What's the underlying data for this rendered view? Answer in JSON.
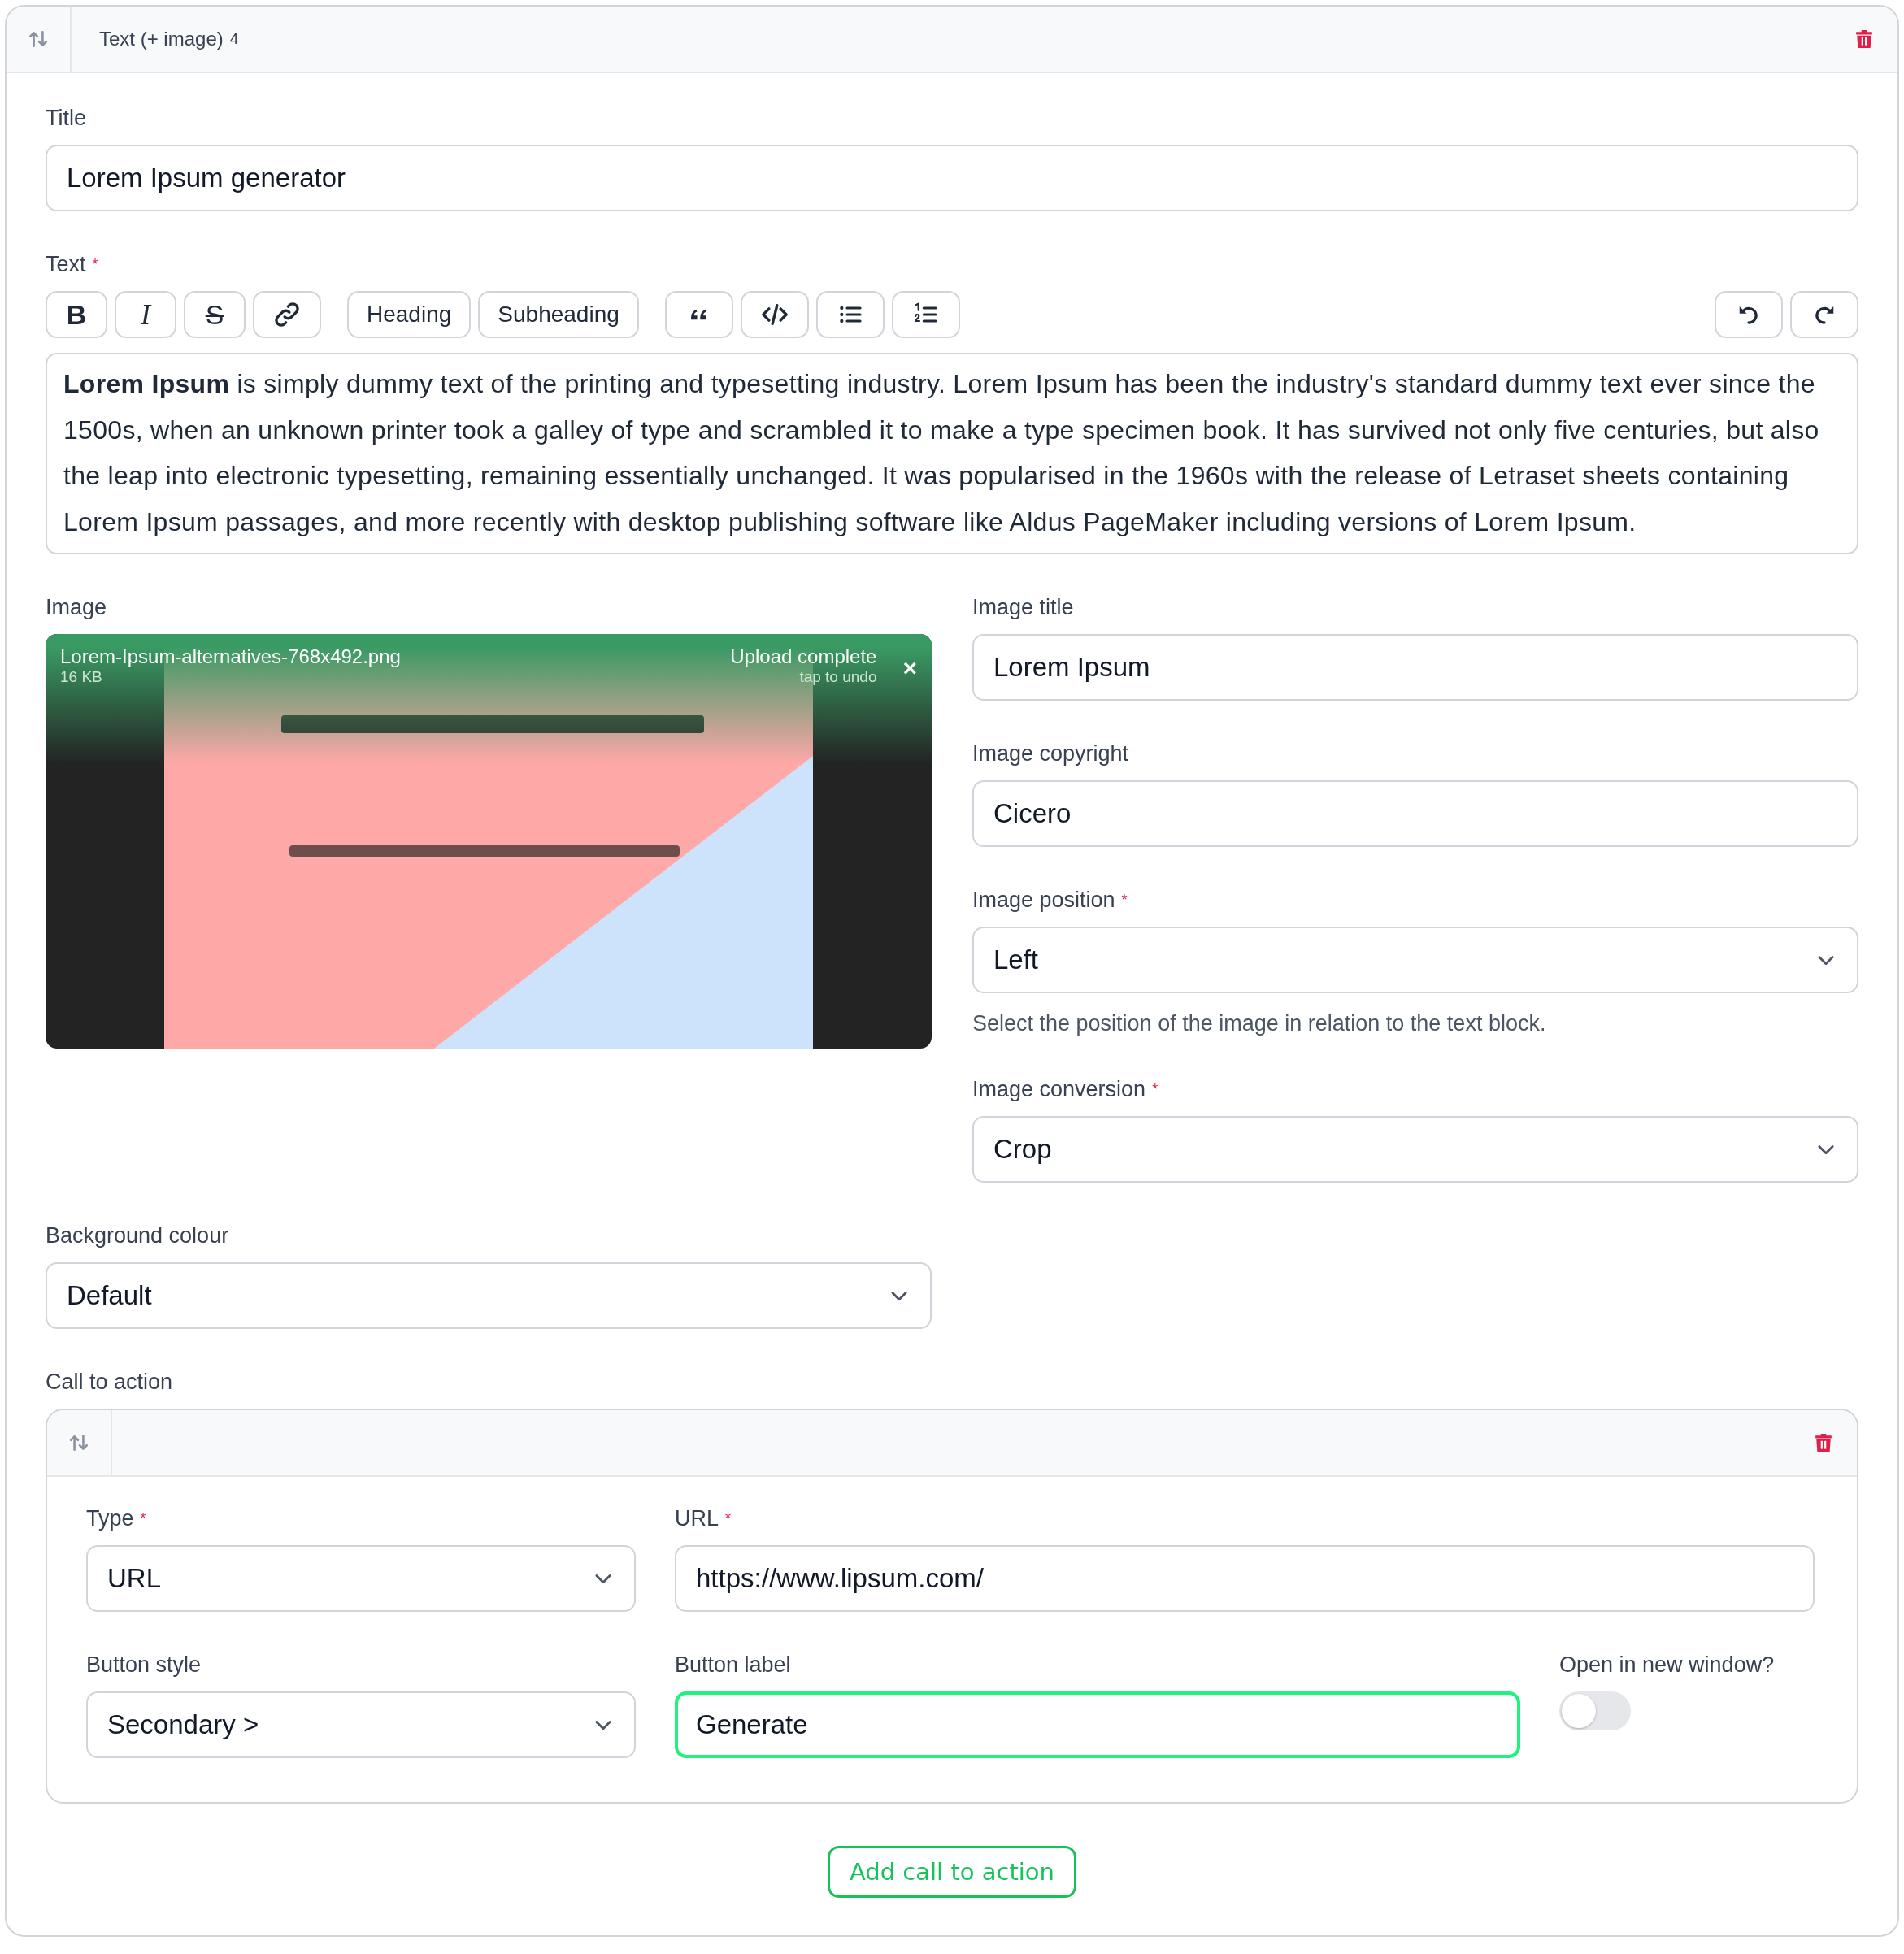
{
  "block": {
    "title": "Text (+ image)",
    "count": "4"
  },
  "title_field": {
    "label": "Title",
    "value": "Lorem Ipsum generator"
  },
  "text_field": {
    "label": "Text",
    "required_mark": "*",
    "toolbar": [
      {
        "tools": [
          {
            "kind": "bold",
            "label": "B"
          },
          {
            "kind": "italic",
            "label": "I"
          },
          {
            "kind": "strike",
            "label": "S"
          },
          {
            "kind": "link"
          }
        ]
      },
      {
        "tools": [
          {
            "kind": "text",
            "label": "Heading"
          },
          {
            "kind": "text",
            "label": "Subheading"
          }
        ]
      },
      {
        "tools": [
          {
            "kind": "quote"
          },
          {
            "kind": "code"
          },
          {
            "kind": "bullets"
          },
          {
            "kind": "numbers"
          }
        ]
      }
    ],
    "history": [
      {
        "kind": "undo"
      },
      {
        "kind": "redo"
      }
    ],
    "content": "**Lorem Ipsum** is simply dummy text of the printing and typesetting industry. Lorem Ipsum has been the industry's standard dummy text ever since the 1500s, when an unknown printer took a galley of type and scrambled it to make a type specimen book. It has survived not only five centuries, but also the leap into electronic typesetting, remaining essentially unchanged. It was popularised in the 1960s with the release of Letraset sheets containing Lorem Ipsum passages, and more recently with desktop publishing software like Aldus PageMaker including versions of Lorem Ipsum."
  },
  "image": {
    "label": "Image",
    "file_name": "Lorem-Ipsum-alternatives-768x492.png",
    "file_size": "16 KB",
    "status": "Upload complete",
    "hint": "tap to undo",
    "close_label": "×",
    "kind": "picture"
  },
  "image_fields": [
    {
      "kind": "text",
      "label": "Image title",
      "value": "Lorem Ipsum"
    },
    {
      "kind": "text",
      "label": "Image copyright",
      "value": "Cicero"
    },
    {
      "kind": "select",
      "label": "Image position",
      "required_mark": "*",
      "value": "Left",
      "help": "Select the position of the image in relation to the text block."
    },
    {
      "kind": "select",
      "label": "Image conversion",
      "required_mark": "*",
      "value": "Crop"
    }
  ],
  "background": {
    "kind": "select",
    "label": "Background colour",
    "value": "Default"
  },
  "call_to_action": {
    "label": "Call to action",
    "fields": [
      {
        "kind": "select",
        "label": "Type",
        "required_mark": "*",
        "value": "URL",
        "focused": false
      },
      {
        "kind": "text",
        "label": "URL",
        "required_mark": "*",
        "value": "https://www.lipsum.com/",
        "focused": false
      },
      {
        "kind": "select",
        "label": "Button style",
        "value": "Secondary >",
        "focused": false
      },
      {
        "kind": "text",
        "label": "Button label",
        "value": "Generate",
        "focused": true
      },
      {
        "kind": "toggle",
        "label": "Open in new window?",
        "on": false
      }
    ],
    "add_button": "Add call to action"
  }
}
